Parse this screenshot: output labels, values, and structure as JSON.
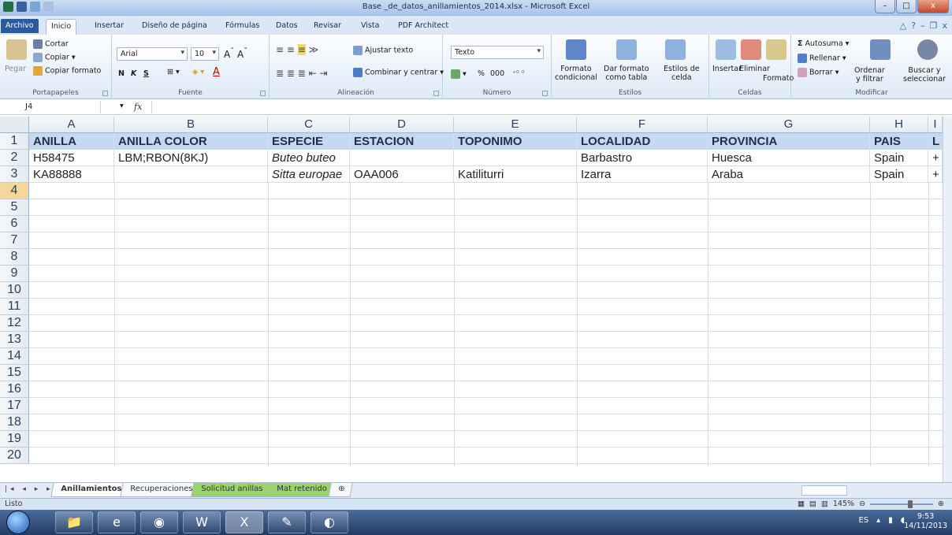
{
  "window": {
    "title": "Base _de_datos_anillamientos_2014.xlsx - Microsoft Excel",
    "buttons": [
      "–",
      "□",
      "x"
    ]
  },
  "tabs": {
    "file": "Archivo",
    "items": [
      "Inicio",
      "Insertar",
      "Diseño de página",
      "Fórmulas",
      "Datos",
      "Revisar",
      "Vista",
      "PDF Architect"
    ]
  },
  "ribbon": {
    "clipboard": {
      "paste": "Pegar",
      "cut": "Cortar",
      "copy": "Copiar ▾",
      "format_painter": "Copiar formato",
      "label": "Portapapeles"
    },
    "font": {
      "name": "Arial",
      "size": "10",
      "bold": "N",
      "italic": "K",
      "underline": "S",
      "label": "Fuente"
    },
    "alignment": {
      "wrap": "Ajustar texto",
      "merge": "Combinar y centrar",
      "label": "Alineación"
    },
    "number": {
      "format": "Texto",
      "percent": "%",
      "thousands": "000",
      "label": "Número"
    },
    "styles": {
      "conditional": "Formato\ncondicional",
      "as_table": "Dar formato\ncomo tabla",
      "cell_styles": "Estilos de\ncelda",
      "label": "Estilos"
    },
    "cells": {
      "insert": "Insertar",
      "delete": "Eliminar",
      "format": "Formato",
      "label": "Celdas"
    },
    "editing": {
      "autosum": "Autosuma",
      "fill": "Rellenar",
      "clear": "Borrar",
      "sort": "Ordenar\ny filtrar",
      "find": "Buscar y\nseleccionar",
      "label": "Modificar"
    }
  },
  "formula_bar": {
    "name_box": "J4",
    "fx": "fx",
    "value": ""
  },
  "columns": [
    "A",
    "B",
    "C",
    "D",
    "E",
    "F",
    "G",
    "H",
    "I"
  ],
  "rows": [
    "1",
    "2",
    "3",
    "4",
    "5",
    "6",
    "7",
    "8",
    "9",
    "10",
    "11",
    "12",
    "13",
    "14",
    "15",
    "16",
    "17",
    "18",
    "19",
    "20"
  ],
  "cells": {
    "r1": [
      "ANILLA",
      "ANILLA COLOR",
      "ESPECIE",
      "ESTACION",
      "TOPONIMO",
      "LOCALIDAD",
      "PROVINCIA",
      "PAIS",
      "L"
    ],
    "r2": [
      "H58475",
      "LBM;RBON(8KJ)",
      "Buteo buteo",
      "",
      "",
      "Barbastro",
      "Huesca",
      "Spain",
      "+"
    ],
    "r3": [
      "KA88888",
      "",
      "Sitta europae",
      "OAA006",
      "Katiliturri",
      "Izarra",
      "Araba",
      "Spain",
      "+"
    ]
  },
  "sheets": [
    "Anillamientos",
    "Recuperaciones",
    "Solicitud anillas",
    "Mat retenido"
  ],
  "status": {
    "text": "Listo",
    "zoom": "145%"
  },
  "taskbar": {
    "lang": "ES",
    "time": "9:53",
    "date": "14/11/2013"
  },
  "colors": {
    "header_fill": "#c5d9f1",
    "file_tab": "#2c5aa0",
    "sheet_green": "#9ad46a"
  }
}
